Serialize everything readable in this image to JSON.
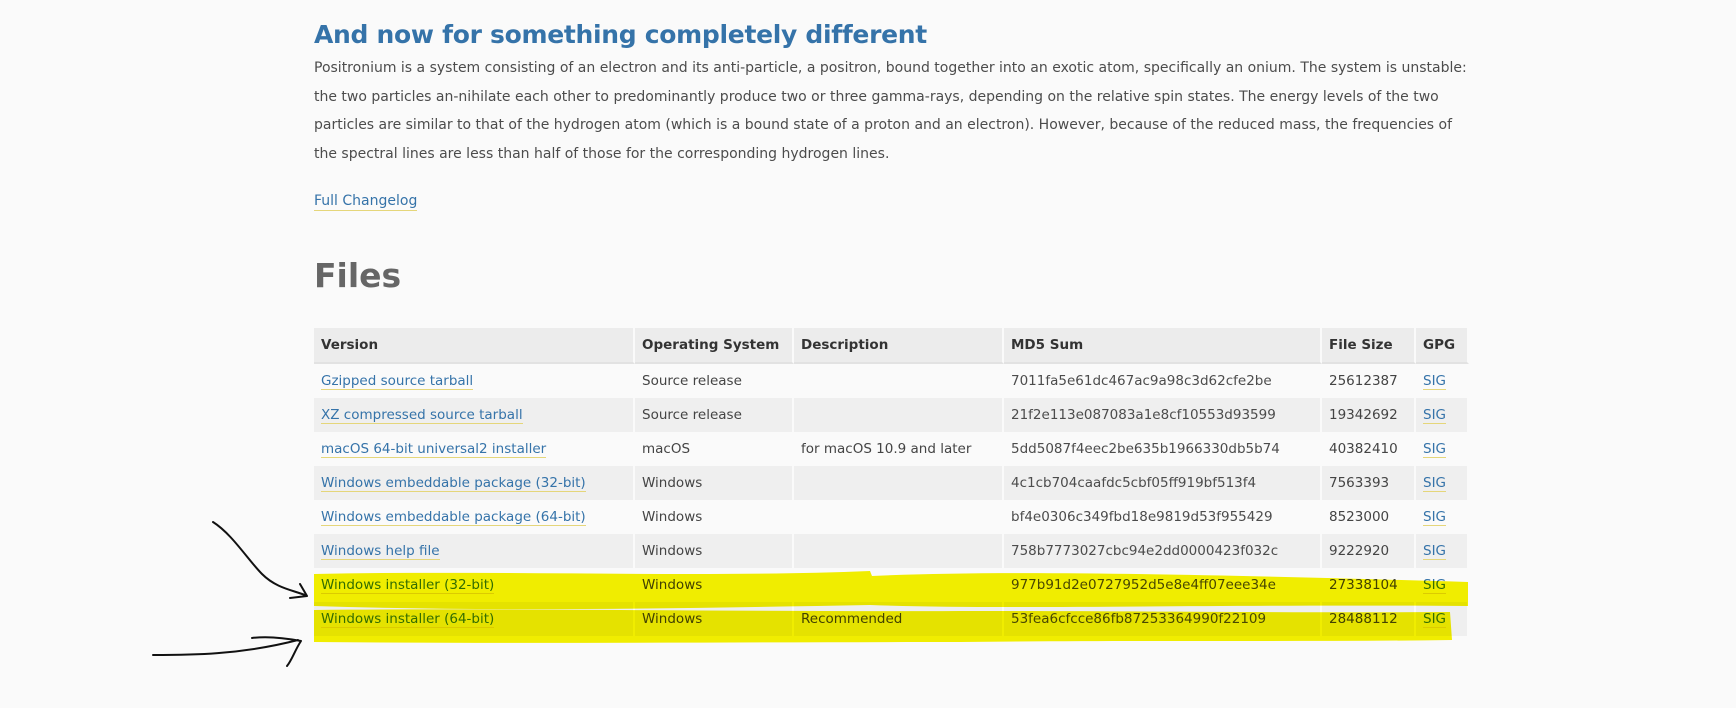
{
  "section": {
    "title": "And now for something completely different",
    "paragraph": "Positronium is a system consisting of an electron and its anti-particle, a positron, bound together into an exotic atom, specifically an onium. The system is unstable: the two particles an-nihilate each other to predominantly produce two or three gamma-rays, depending on the relative spin states. The energy levels of the two particles are similar to that of the hydrogen atom (which is a bound state of a proton and an electron). However, because of the reduced mass, the frequencies of the spectral lines are less than half of those for the corresponding hydrogen lines.",
    "changelog_link": "Full Changelog"
  },
  "files": {
    "title": "Files",
    "columns": [
      "Version",
      "Operating System",
      "Description",
      "MD5 Sum",
      "File Size",
      "GPG"
    ],
    "rows": [
      {
        "version": "Gzipped source tarball",
        "os": "Source release",
        "description": "",
        "md5": "7011fa5e61dc467ac9a98c3d62cfe2be",
        "size": "25612387",
        "gpg": "SIG"
      },
      {
        "version": "XZ compressed source tarball",
        "os": "Source release",
        "description": "",
        "md5": "21f2e113e087083a1e8cf10553d93599",
        "size": "19342692",
        "gpg": "SIG"
      },
      {
        "version": "macOS 64-bit universal2 installer",
        "os": "macOS",
        "description": "for macOS 10.9 and later",
        "md5": "5dd5087f4eec2be635b1966330db5b74",
        "size": "40382410",
        "gpg": "SIG"
      },
      {
        "version": "Windows embeddable package (32-bit)",
        "os": "Windows",
        "description": "",
        "md5": "4c1cb704caafdc5cbf05ff919bf513f4",
        "size": "7563393",
        "gpg": "SIG"
      },
      {
        "version": "Windows embeddable package (64-bit)",
        "os": "Windows",
        "description": "",
        "md5": "bf4e0306c349fbd18e9819d53f955429",
        "size": "8523000",
        "gpg": "SIG"
      },
      {
        "version": "Windows help file",
        "os": "Windows",
        "description": "",
        "md5": "758b7773027cbc94e2dd0000423f032c",
        "size": "9222920",
        "gpg": "SIG"
      },
      {
        "version": "Windows installer (32-bit)",
        "os": "Windows",
        "description": "",
        "md5": "977b91d2e0727952d5e8e4ff07eee34e",
        "size": "27338104",
        "gpg": "SIG"
      },
      {
        "version": "Windows installer (64-bit)",
        "os": "Windows",
        "description": "Recommended",
        "md5": "53fea6cfcce86fb87253364990f22109",
        "size": "28488112",
        "gpg": "SIG"
      }
    ]
  },
  "annotations": {
    "highlight_color": "#f5f200",
    "arrow_color": "#111111",
    "highlighted_rows": [
      "Windows installer (32-bit)",
      "Windows installer (64-bit)"
    ]
  }
}
